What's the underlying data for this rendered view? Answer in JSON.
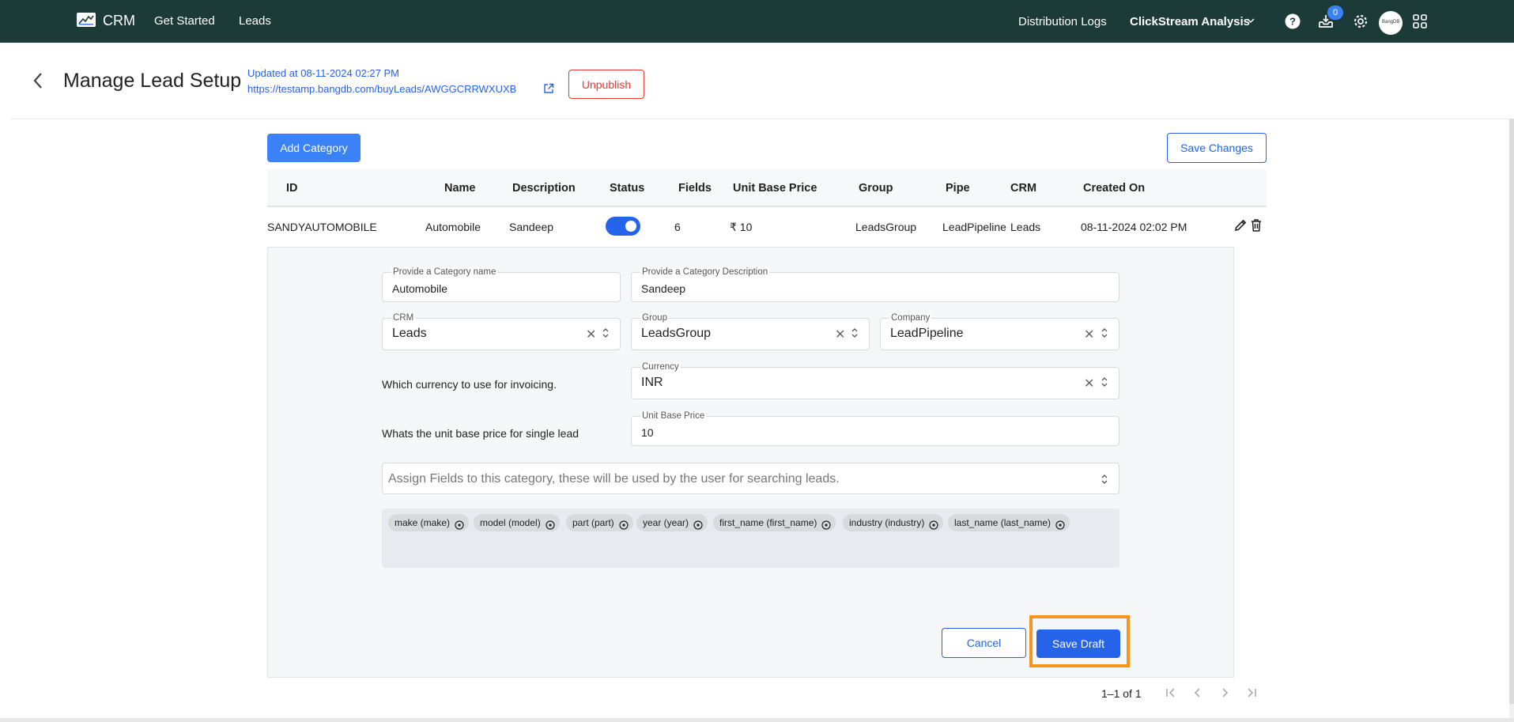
{
  "nav": {
    "brand": "CRM",
    "links": [
      "Get Started",
      "Leads"
    ],
    "distribution_logs": "Distribution Logs",
    "workspace": "ClickStream Analysis",
    "notifications_count": "0",
    "avatar_text": "BangDB"
  },
  "header": {
    "title": "Manage Lead Setup",
    "updated": "Updated at 08-11-2024 02:27 PM",
    "url": "https://testamp.bangdb.com/buyLeads/AWGGCRRWXUXB",
    "unpublish_label": "Unpublish"
  },
  "toolbar": {
    "add_category": "Add Category",
    "save_changes": "Save Changes"
  },
  "table": {
    "columns": [
      "ID",
      "Name",
      "Description",
      "Status",
      "Fields",
      "Unit Base Price",
      "Group",
      "Pipe",
      "CRM",
      "Created On"
    ],
    "row": {
      "id": "SANDYAUTOMOBILE",
      "name": "Automobile",
      "description": "Sandeep",
      "status_on": true,
      "fields": "6",
      "price": "₹ 10",
      "group": "LeadsGroup",
      "pipe": "LeadPipeline",
      "crm": "Leads",
      "created": "08-11-2024 02:02 PM"
    }
  },
  "form": {
    "category_name_label": "Provide a Category name",
    "category_name": "Automobile",
    "category_desc_label": "Provide a Category Description",
    "category_desc": "Sandeep",
    "crm_label": "CRM",
    "crm": "Leads",
    "group_label": "Group",
    "group": "LeadsGroup",
    "company_label": "Company",
    "company": "LeadPipeline",
    "currency_question": "Which currency to use for invoicing.",
    "currency_label": "Currency",
    "currency": "INR",
    "price_question": "Whats the unit base price for single lead",
    "price_label": "Unit Base Price",
    "price": "10",
    "assign_placeholder": "Assign Fields to this category, these will be used by the user for searching leads.",
    "chips": [
      "make (make)",
      "model (model)",
      "part (part)",
      "year (year)",
      "first_name (first_name)",
      "industry (industry)",
      "last_name (last_name)"
    ],
    "cancel": "Cancel",
    "save_draft": "Save Draft"
  },
  "pagination": {
    "text": "1–1 of 1"
  },
  "colors": {
    "nav_bg": "#1c3b38",
    "primary": "#2563eb",
    "danger": "#e53935",
    "highlight": "#f7931e"
  }
}
